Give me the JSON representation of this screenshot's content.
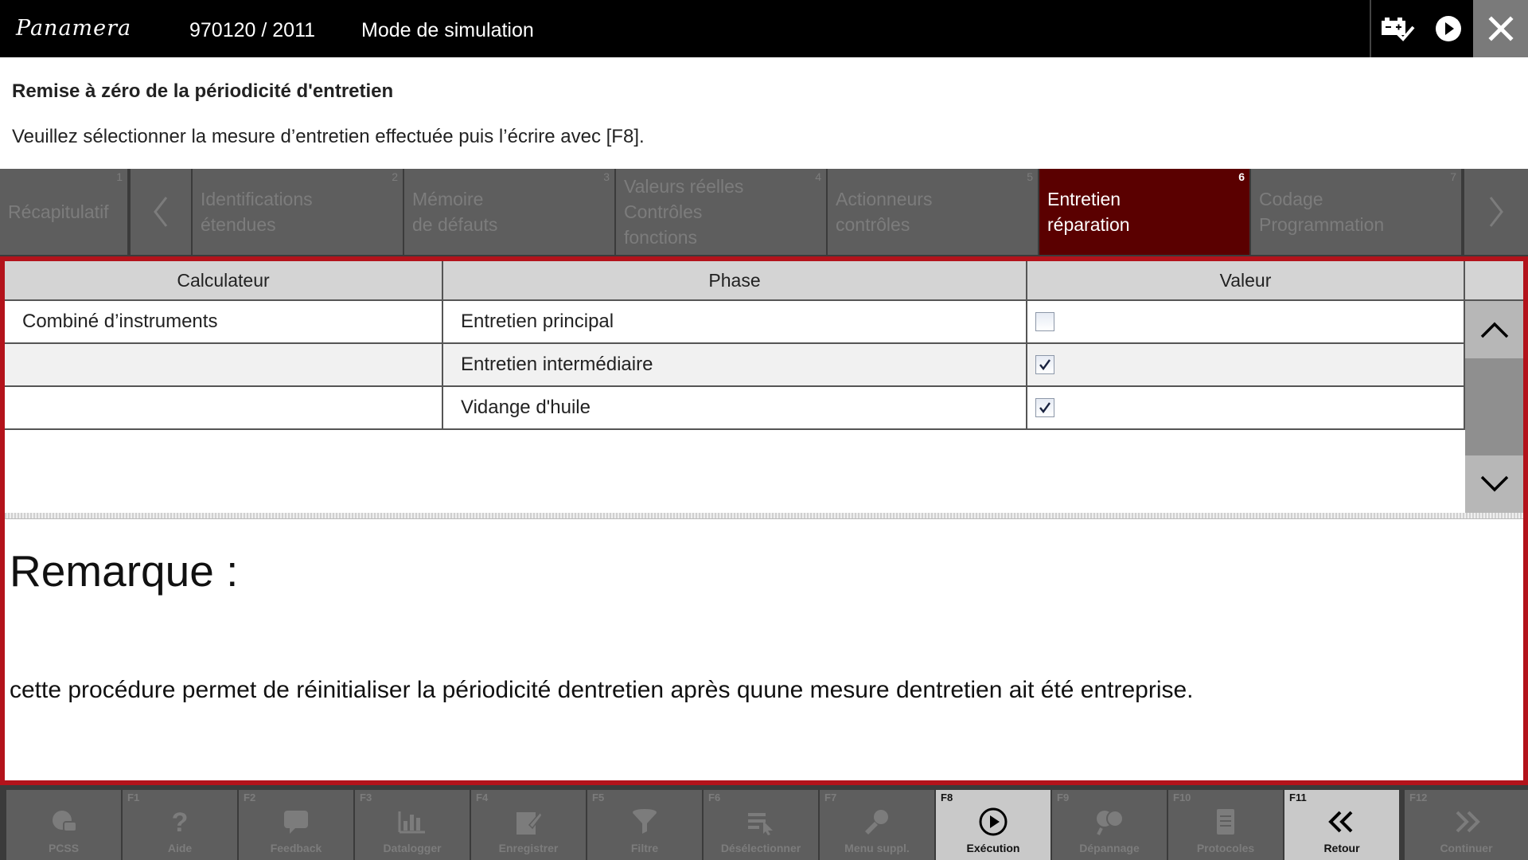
{
  "titlebar": {
    "model": "Panamera",
    "vehicle_code": "970120 / 2011",
    "mode": "Mode de simulation"
  },
  "header": {
    "title": "Remise à zéro de la périodicité d'entretien",
    "instruction": "Veuillez sélectionner la mesure d’entretien effectuée puis l’écrire avec [F8]."
  },
  "tabs": [
    {
      "num": "1",
      "lines": [
        "Récapitulatif"
      ],
      "active": false
    },
    {
      "num": "2",
      "lines": [
        "Identifications",
        "étendues"
      ],
      "active": false
    },
    {
      "num": "3",
      "lines": [
        "Mémoire",
        "de défauts"
      ],
      "active": false
    },
    {
      "num": "4",
      "lines": [
        "Valeurs réelles",
        "Contrôles",
        "fonctions"
      ],
      "active": false
    },
    {
      "num": "5",
      "lines": [
        "Actionneurs",
        "contrôles"
      ],
      "active": false
    },
    {
      "num": "6",
      "lines": [
        "Entretien",
        "réparation"
      ],
      "active": true
    },
    {
      "num": "7",
      "lines": [
        "Codage",
        "Programmation"
      ],
      "active": false
    }
  ],
  "table": {
    "columns": [
      "Calculateur",
      "Phase",
      "Valeur"
    ],
    "rows": [
      {
        "calculateur": "Combiné d’instruments",
        "phase": "Entretien principal",
        "checked": false
      },
      {
        "calculateur": "",
        "phase": "Entretien intermédiaire",
        "checked": true
      },
      {
        "calculateur": "",
        "phase": "Vidange d'huile",
        "checked": true
      }
    ]
  },
  "remark": {
    "title": "Remarque :",
    "text": "cette procédure permet de réinitialiser la périodicité dentretien après quune mesure dentretien ait été entreprise."
  },
  "fkeys": [
    {
      "key": "",
      "label": "PCSS",
      "icon": "pcss-icon",
      "enabled": false
    },
    {
      "key": "F1",
      "label": "Aide",
      "icon": "help-icon",
      "enabled": false
    },
    {
      "key": "F2",
      "label": "Feedback",
      "icon": "feedback-icon",
      "enabled": false
    },
    {
      "key": "F3",
      "label": "Datalogger",
      "icon": "datalogger-icon",
      "enabled": false
    },
    {
      "key": "F4",
      "label": "Enregistrer",
      "icon": "save-icon",
      "enabled": false
    },
    {
      "key": "F5",
      "label": "Filtre",
      "icon": "filter-icon",
      "enabled": false
    },
    {
      "key": "F6",
      "label": "Désélectionner",
      "icon": "deselect-icon",
      "enabled": false
    },
    {
      "key": "F7",
      "label": "Menu suppl.",
      "icon": "extra-menu-icon",
      "enabled": false
    },
    {
      "key": "F8",
      "label": "Exécution",
      "icon": "execute-icon",
      "enabled": true
    },
    {
      "key": "F9",
      "label": "Dépannage",
      "icon": "troubleshoot-icon",
      "enabled": false
    },
    {
      "key": "F10",
      "label": "Protocoles",
      "icon": "protocols-icon",
      "enabled": false
    },
    {
      "key": "F11",
      "label": "Retour",
      "icon": "back-icon",
      "enabled": true
    },
    {
      "key": "F12",
      "label": "Continuer",
      "icon": "continue-icon",
      "enabled": false
    }
  ]
}
